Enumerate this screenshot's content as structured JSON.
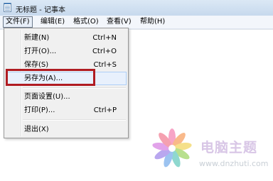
{
  "window": {
    "title": "无标题 - 记事本"
  },
  "menubar": {
    "items": [
      {
        "label": "文件(F)"
      },
      {
        "label": "编辑(E)"
      },
      {
        "label": "格式(O)"
      },
      {
        "label": "查看(V)"
      },
      {
        "label": "帮助(H)"
      }
    ]
  },
  "file_menu": {
    "items": [
      {
        "label": "新建(N)",
        "shortcut": "Ctrl+N"
      },
      {
        "label": "打开(O)...",
        "shortcut": "Ctrl+O"
      },
      {
        "label": "保存(S)",
        "shortcut": "Ctrl+S"
      },
      {
        "label": "另存为(A)...",
        "shortcut": ""
      },
      {
        "label": "页面设置(U)...",
        "shortcut": ""
      },
      {
        "label": "打印(P)...",
        "shortcut": "Ctrl+P"
      },
      {
        "label": "退出(X)",
        "shortcut": ""
      }
    ],
    "highlighted_item": "另存为(A)..."
  },
  "annotation": {
    "color": "#b01c22"
  },
  "watermark": {
    "brand": "电脑主题",
    "url": "www.dnzhuti.com"
  }
}
